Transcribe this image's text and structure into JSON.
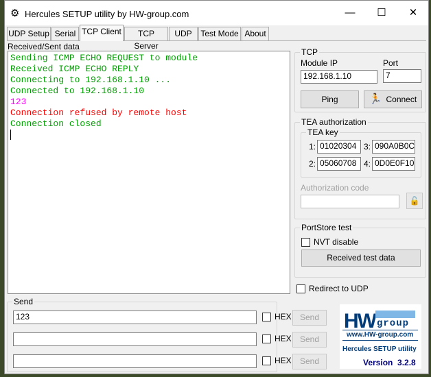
{
  "window": {
    "title": "Hercules SETUP utility by HW-group.com"
  },
  "tabs": [
    {
      "label": "UDP Setup"
    },
    {
      "label": "Serial"
    },
    {
      "label": "TCP Client",
      "active": true
    },
    {
      "label": "TCP Server"
    },
    {
      "label": "UDP"
    },
    {
      "label": "Test Mode"
    },
    {
      "label": "About"
    }
  ],
  "received": {
    "label": "Received/Sent data",
    "lines": [
      {
        "text": "Sending ICMP ECHO REQUEST to module",
        "color": "#00a000"
      },
      {
        "text": "Received ICMP ECHO REPLY",
        "color": "#00a000"
      },
      {
        "text": "Connecting to 192.168.1.10 ...",
        "color": "#00a000"
      },
      {
        "text": "Connected to 192.168.1.10",
        "color": "#00a000"
      },
      {
        "text": "123",
        "color": "#ff00ff"
      },
      {
        "text": "Connection refused by remote host",
        "color": "#ff0000"
      },
      {
        "text": "Connection closed",
        "color": "#00a000"
      }
    ]
  },
  "tcp": {
    "label": "TCP",
    "module_ip_label": "Module IP",
    "module_ip": "192.168.1.10",
    "port_label": "Port",
    "port": "7",
    "ping": "Ping",
    "connect": "Connect"
  },
  "tea": {
    "label": "TEA authorization",
    "key_label": "TEA key",
    "k1_label": "1:",
    "k1": "01020304",
    "k2_label": "2:",
    "k2": "05060708",
    "k3_label": "3:",
    "k3": "090A0B0C",
    "k4_label": "4:",
    "k4": "0D0E0F10",
    "auth_label": "Authorization code",
    "auth_value": ""
  },
  "portstore": {
    "label": "PortStore test",
    "nvt": "NVT disable",
    "received_btn": "Received test data"
  },
  "redirect": "Redirect to UDP",
  "send": {
    "label": "Send",
    "rows": [
      {
        "value": "123",
        "hex": "HEX",
        "button": "Send"
      },
      {
        "value": "",
        "hex": "HEX",
        "button": "Send"
      },
      {
        "value": "",
        "hex": "HEX",
        "button": "Send"
      }
    ]
  },
  "logo": {
    "hw": "HW",
    "group": "group",
    "url": "www.HW-group.com",
    "product": "Hercules SETUP utility",
    "version_label": "Version",
    "version": "3.2.8"
  }
}
